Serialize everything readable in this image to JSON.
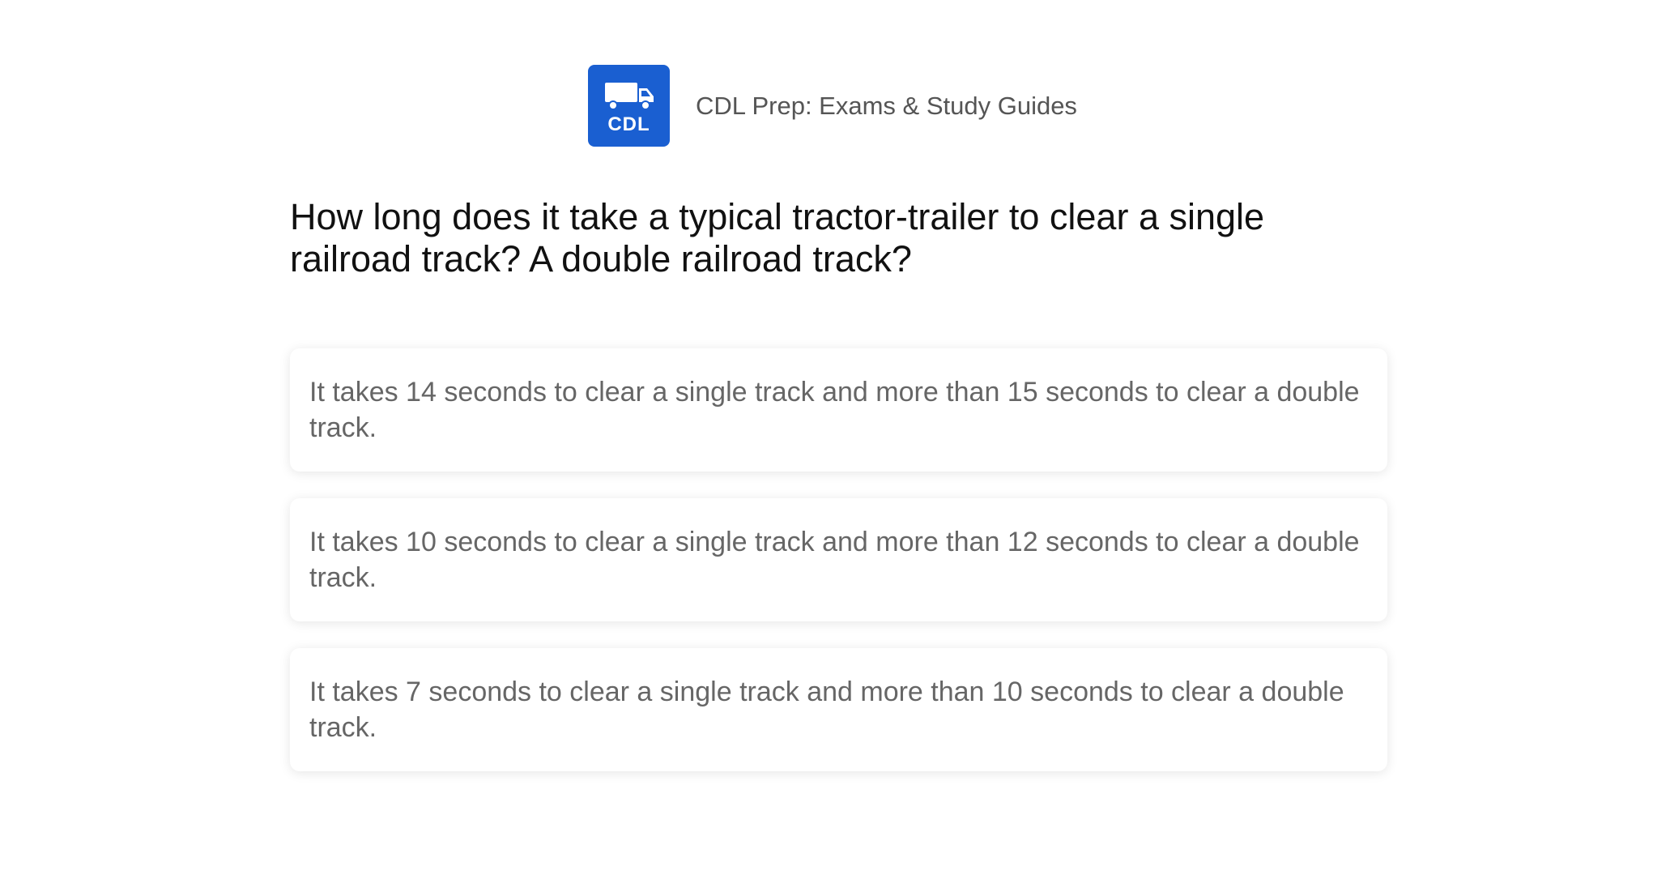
{
  "app": {
    "logo_text": "CDL",
    "logo_color": "#1a5fd1",
    "logo_icon": "truck-icon",
    "name": "CDL Prep: Exams & Study Guides"
  },
  "question": {
    "text": "How long does it take a typical tractor-trailer to clear a single railroad track? A double railroad track?"
  },
  "answers": [
    {
      "text": "It takes 14 seconds to clear a single track and more than 15 seconds to clear a double track."
    },
    {
      "text": "It takes 10 seconds to clear a single track and more than 12 seconds to clear a double track."
    },
    {
      "text": "It takes 7 seconds to clear a single track and more than 10 seconds to clear a double track."
    }
  ]
}
